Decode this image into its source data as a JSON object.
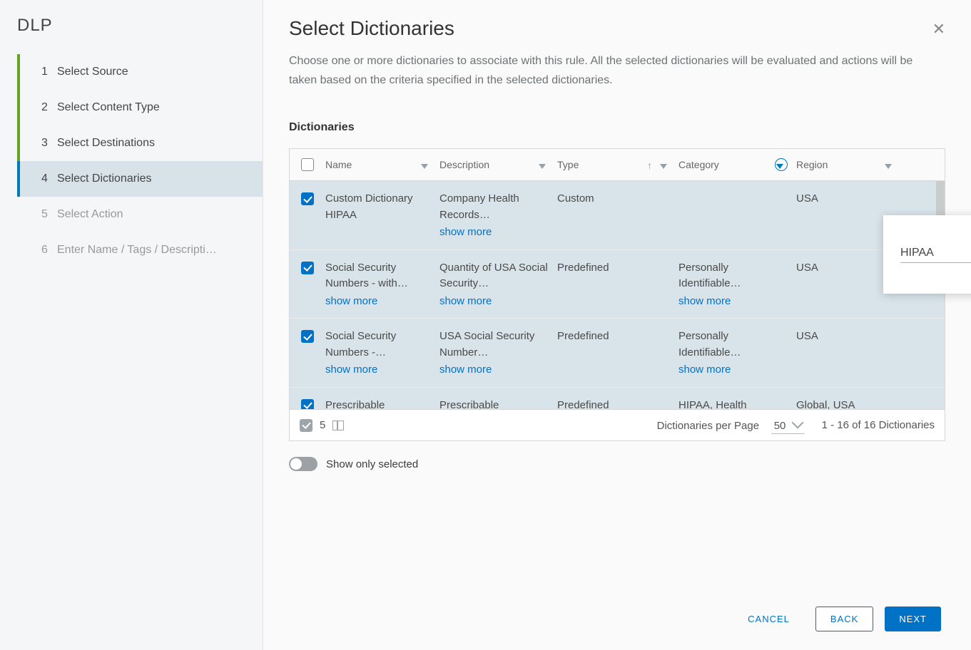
{
  "app_title": "DLP",
  "steps": [
    {
      "num": "1",
      "label": "Select Source",
      "state": "done"
    },
    {
      "num": "2",
      "label": "Select Content Type",
      "state": "done"
    },
    {
      "num": "3",
      "label": "Select Destinations",
      "state": "done"
    },
    {
      "num": "4",
      "label": "Select Dictionaries",
      "state": "active"
    },
    {
      "num": "5",
      "label": "Select Action",
      "state": "disabled"
    },
    {
      "num": "6",
      "label": "Enter Name / Tags / Descripti…",
      "state": "disabled"
    }
  ],
  "page": {
    "title": "Select Dictionaries",
    "description": "Choose one or more dictionaries to associate with this rule. All the selected dictionaries will be evaluated and actions will be taken based on the criteria specified in the selected dictionaries.",
    "section": "Dictionaries"
  },
  "columns": {
    "name": "Name",
    "description": "Description",
    "type": "Type",
    "category": "Category",
    "region": "Region"
  },
  "rows": [
    {
      "selected": true,
      "name": "Custom Dictionary HIPAA",
      "name_more": false,
      "desc": "Company Health Records…",
      "desc_more": true,
      "type": "Custom",
      "cat": "",
      "cat_more": false,
      "region": "USA"
    },
    {
      "selected": true,
      "name": "Social Security Numbers - with…",
      "name_more": true,
      "desc": "Quantity of USA Social Security…",
      "desc_more": true,
      "type": "Predefined",
      "cat": "Personally Identifiable…",
      "cat_more": true,
      "region": "USA"
    },
    {
      "selected": true,
      "name": "Social Security Numbers -…",
      "name_more": true,
      "desc": "USA Social Security Number…",
      "desc_more": true,
      "type": "Predefined",
      "cat": "Personally Identifiable…",
      "cat_more": true,
      "region": "USA"
    },
    {
      "selected": true,
      "name": "Prescribable",
      "name_more": false,
      "desc": "Prescribable",
      "desc_more": false,
      "type": "Predefined",
      "cat": "HIPAA, Health",
      "cat_more": false,
      "region": "Global, USA"
    }
  ],
  "show_more_label": "show more",
  "footer": {
    "selected_count": "5",
    "per_page_label": "Dictionaries per Page",
    "per_page_value": "50",
    "range": "1 - 16 of 16 Dictionaries"
  },
  "toggle_label": "Show only selected",
  "filter_popup": {
    "value": "HIPAA"
  },
  "buttons": {
    "cancel": "CANCEL",
    "back": "BACK",
    "next": "NEXT"
  }
}
